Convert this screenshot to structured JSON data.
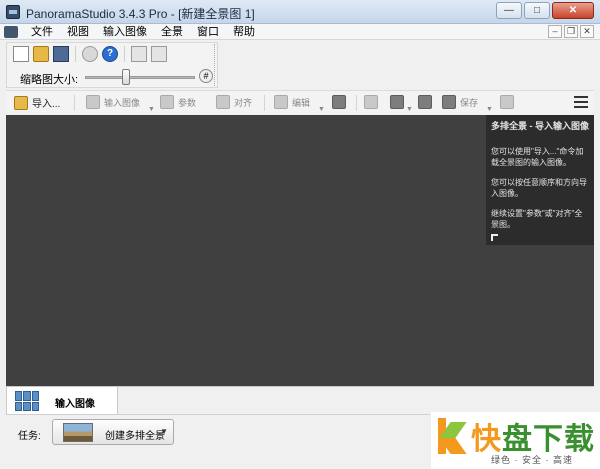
{
  "window": {
    "title": "PanoramaStudio 3.4.3 Pro - [新建全景图 1]",
    "minimize": "—",
    "maximize": "□",
    "close": "✕"
  },
  "menu": {
    "items": [
      "文件",
      "视图",
      "输入图像",
      "全景",
      "窗口",
      "帮助"
    ],
    "mdi_minimize": "–",
    "mdi_restore": "❐",
    "mdi_close": "✕"
  },
  "quickbar": {
    "icons": [
      "new-file-icon",
      "open-folder-icon",
      "save-icon",
      "info-icon",
      "help-icon",
      "copy-icon",
      "paste-icon"
    ],
    "help_glyph": "?",
    "thumbnail_size_label": "缩略图大小:",
    "hash_glyph": "#"
  },
  "toolbar": {
    "import": "导入...",
    "input_images": "输入图像",
    "parameters": "参数",
    "align": "对齐",
    "edit": "编辑",
    "save": "保存"
  },
  "help_panel": {
    "title": "多排全景 - 导入输入图像",
    "p1": "您可以使用\"导入...\"命令加载全景图的输入图像。",
    "p2": "您可以按任意顺序和方向导入图像。",
    "p3": "继续设置\"参数\"或\"对齐\"全景图。"
  },
  "tabs": {
    "input_images": "输入图像"
  },
  "task": {
    "label": "任务:",
    "selected": "创建多排全景"
  },
  "watermark": {
    "title_first": "快",
    "title_rest": "盘下载",
    "subtitle": "绿色 · 安全 · 高速"
  }
}
